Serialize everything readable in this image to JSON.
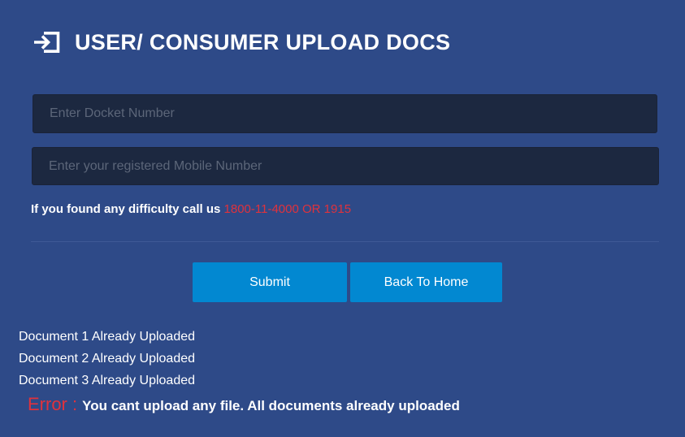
{
  "header": {
    "title": "USER/ CONSUMER UPLOAD DOCS",
    "icon": "sign-in-icon"
  },
  "form": {
    "docket_placeholder": "Enter Docket Number",
    "docket_value": "",
    "mobile_placeholder": "Enter your registered Mobile Number",
    "mobile_value": ""
  },
  "help": {
    "text": "If you found any difficulty call us ",
    "phone": "1800-11-4000 OR 1915"
  },
  "buttons": {
    "submit_label": "Submit",
    "back_label": "Back To Home"
  },
  "status": {
    "items": [
      "Document 1 Already Uploaded",
      "Document 2 Already Uploaded",
      "Document 3 Already Uploaded"
    ]
  },
  "error": {
    "label": "Error :",
    "message": "You cant upload any file. All documents already uploaded"
  },
  "colors": {
    "background": "#2e4a88",
    "input_background": "#1c2840",
    "button": "#0288d1",
    "accent_red": "#e0323c"
  }
}
